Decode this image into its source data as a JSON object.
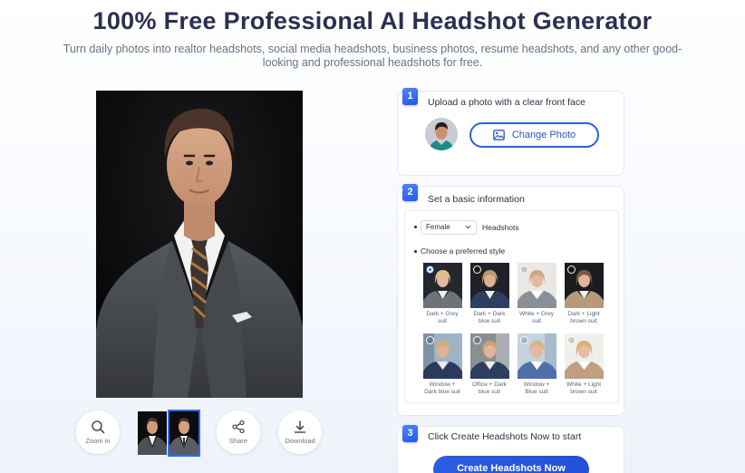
{
  "header": {
    "title": "100% Free Professional AI Headshot Generator",
    "subtitle": "Turn daily photos into realtor headshots, social media headshots, business photos, resume headshots, and any other good-looking and professional headshots for free."
  },
  "toolbar": {
    "zoom_label": "Zoom in",
    "share_label": "Share",
    "download_label": "Download",
    "selected_thumbnail": 2
  },
  "step1": {
    "number": "1",
    "title": "Upload a photo with a clear front face",
    "change_button": "Change Photo"
  },
  "step2": {
    "number": "2",
    "title": "Set a basic information",
    "gender_value": "Female",
    "gender_suffix": "Headshots",
    "style_heading": "Choose a preferred style",
    "styles": [
      {
        "l1": "Dark + Grey",
        "l2": "suit",
        "selected": true
      },
      {
        "l1": "Dark + Dark",
        "l2": "blue suit",
        "selected": false
      },
      {
        "l1": "White + Grey",
        "l2": "suit",
        "selected": false
      },
      {
        "l1": "Dark + Light",
        "l2": "brown suit",
        "selected": false
      },
      {
        "l1": "Window +",
        "l2": "Dark blue suit",
        "selected": false
      },
      {
        "l1": "Office + Dark",
        "l2": "blue suit",
        "selected": false
      },
      {
        "l1": "Window +",
        "l2": "Blue suit",
        "selected": false
      },
      {
        "l1": "White + Light",
        "l2": "brown suit",
        "selected": false
      }
    ]
  },
  "step3": {
    "number": "3",
    "title": "Click Create Headshots Now to start",
    "create_button": "Create Headshots Now"
  },
  "colors": {
    "accent": "#2f5fe0",
    "title": "#2b3050"
  }
}
